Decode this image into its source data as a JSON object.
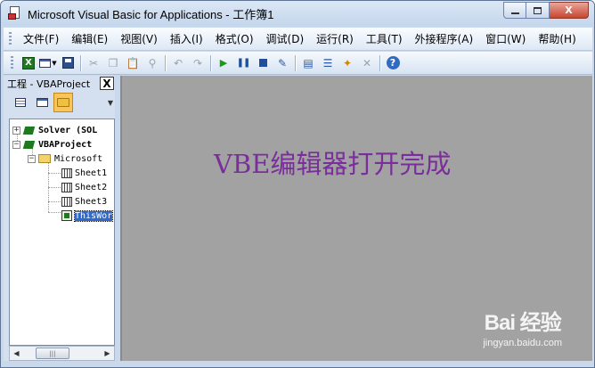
{
  "window": {
    "title": "Microsoft Visual Basic for Applications - 工作簿1",
    "min_label": "",
    "max_label": "",
    "close_label": "X"
  },
  "menu": {
    "items": [
      {
        "label": "文件(F)"
      },
      {
        "label": "编辑(E)"
      },
      {
        "label": "视图(V)"
      },
      {
        "label": "插入(I)"
      },
      {
        "label": "格式(O)"
      },
      {
        "label": "调试(D)"
      },
      {
        "label": "运行(R)"
      },
      {
        "label": "工具(T)"
      },
      {
        "label": "外接程序(A)"
      },
      {
        "label": "窗口(W)"
      },
      {
        "label": "帮助(H)"
      }
    ]
  },
  "toolbar": {
    "excel_glyph": "X",
    "help_glyph": "?",
    "icons": [
      "view-excel-icon",
      "insert-userform-icon",
      "save-icon",
      "cut-icon",
      "copy-icon",
      "paste-icon",
      "find-icon",
      "undo-icon",
      "redo-icon",
      "run-icon",
      "break-icon",
      "reset-icon",
      "design-mode-icon",
      "project-explorer-icon",
      "properties-icon",
      "object-browser-icon",
      "toolbox-icon",
      "help-icon"
    ]
  },
  "project_panel": {
    "title": "工程 - VBAProject",
    "close_label": "X",
    "tree": {
      "solver": "Solver (SOL",
      "vbaproject": "VBAProject",
      "folder": "Microsoft",
      "sheet1": "Sheet1",
      "sheet2": "Sheet2",
      "sheet3": "Sheet3",
      "thisworkbook": "ThisWor"
    },
    "scroll_thumb_label": "|||"
  },
  "main": {
    "overlay_text": "VBE编辑器打开完成",
    "watermark_brand": "Bai  经验",
    "watermark_url": "jingyan.baidu.com"
  },
  "colors": {
    "overlay_text": "#7a2e9b",
    "mdi_background": "#a2a2a2",
    "selection": "#3069c9",
    "chrome": "#c9d8ea"
  }
}
